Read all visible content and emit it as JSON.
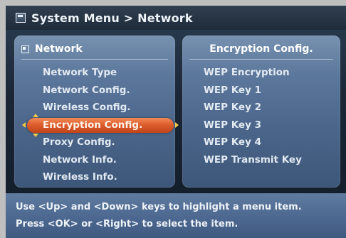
{
  "title_bar": {
    "icon": "menu-icon",
    "text": "System Menu > Network"
  },
  "left_panel": {
    "header_icon": "network-folder-icon",
    "header": "Network",
    "items": [
      {
        "label": "Network Type"
      },
      {
        "label": "Network Config."
      },
      {
        "label": "Wireless Config."
      },
      {
        "label": "Encryption Config.",
        "selected": true
      },
      {
        "label": "Proxy Config."
      },
      {
        "label": "Network Info."
      },
      {
        "label": "Wireless Info."
      }
    ]
  },
  "right_panel": {
    "header": "Encryption Config.",
    "items": [
      {
        "label": "WEP Encryption"
      },
      {
        "label": "WEP Key 1"
      },
      {
        "label": "WEP Key 2"
      },
      {
        "label": "WEP Key 3"
      },
      {
        "label": "WEP Key 4"
      },
      {
        "label": "WEP Transmit Key"
      }
    ]
  },
  "help": {
    "line1": "Use <Up> and <Down> keys to highlight a menu item.",
    "line2": "Press <OK> or <Right> to select the item."
  },
  "colors": {
    "selection": "#db5a2a",
    "arrow": "#f3c84a",
    "panel": "#5c789c",
    "background": "#1a2636"
  }
}
